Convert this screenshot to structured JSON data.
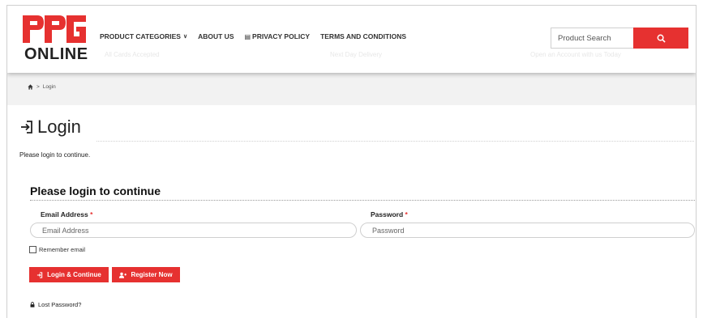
{
  "brand": {
    "logo_mark": "PPG",
    "logo_sub": "ONLINE",
    "accent": "#e63130"
  },
  "nav": {
    "product_categories": "PRODUCT CATEGORIES",
    "about_us": "ABOUT US",
    "privacy_policy": "PRIVACY POLICY",
    "terms": "TERMS AND CONDITIONS"
  },
  "ghost_text": {
    "left": "All Cards Accepted",
    "middle": "Next Day Delivery",
    "right": "Open an Account with us Today"
  },
  "search": {
    "placeholder": "Product Search"
  },
  "breadcrumb": {
    "current": "Login"
  },
  "page": {
    "title": "Login",
    "intro": "Please login to continue."
  },
  "form": {
    "section_title": "Please login to continue",
    "email_label": "Email Address",
    "email_placeholder": "Email Address",
    "password_label": "Password",
    "password_placeholder": "Password",
    "required_mark": "*",
    "remember_label": "Remember email",
    "login_button": "Login & Continue",
    "register_button": "Register Now",
    "lost_password": "Lost Password?"
  }
}
